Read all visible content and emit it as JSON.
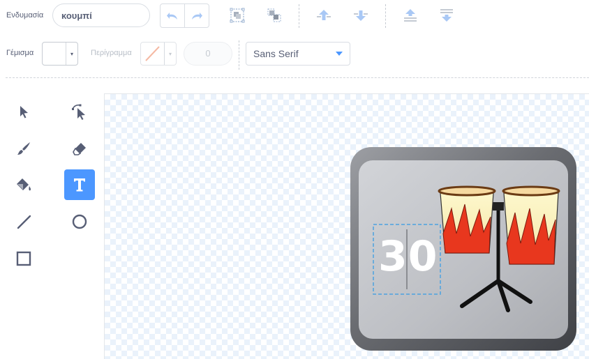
{
  "toolbar": {
    "costume_label": "Ενδυμασία",
    "costume_name": "κουμπί",
    "fill_label": "Γέμισμα",
    "outline_label": "Περίγραμμα",
    "outline_width": "0",
    "font": "Sans Serif",
    "fill_color": "#ffffff"
  },
  "icons": {
    "undo": "undo-icon",
    "redo": "redo-icon",
    "group": "group-icon",
    "ungroup": "ungroup-icon",
    "forward": "forward-icon",
    "backward": "backward-icon",
    "front": "front-icon",
    "back": "back-icon"
  },
  "tools": [
    "select",
    "reshape",
    "brush",
    "eraser",
    "fill",
    "text",
    "line",
    "circle",
    "rectangle"
  ],
  "active_tool": "text",
  "canvas": {
    "text_value": "30"
  },
  "colors": {
    "accent": "#4c97ff",
    "icon": "#575e75",
    "drum_red": "#e8371e",
    "drum_cream": "#fdf6c8"
  }
}
